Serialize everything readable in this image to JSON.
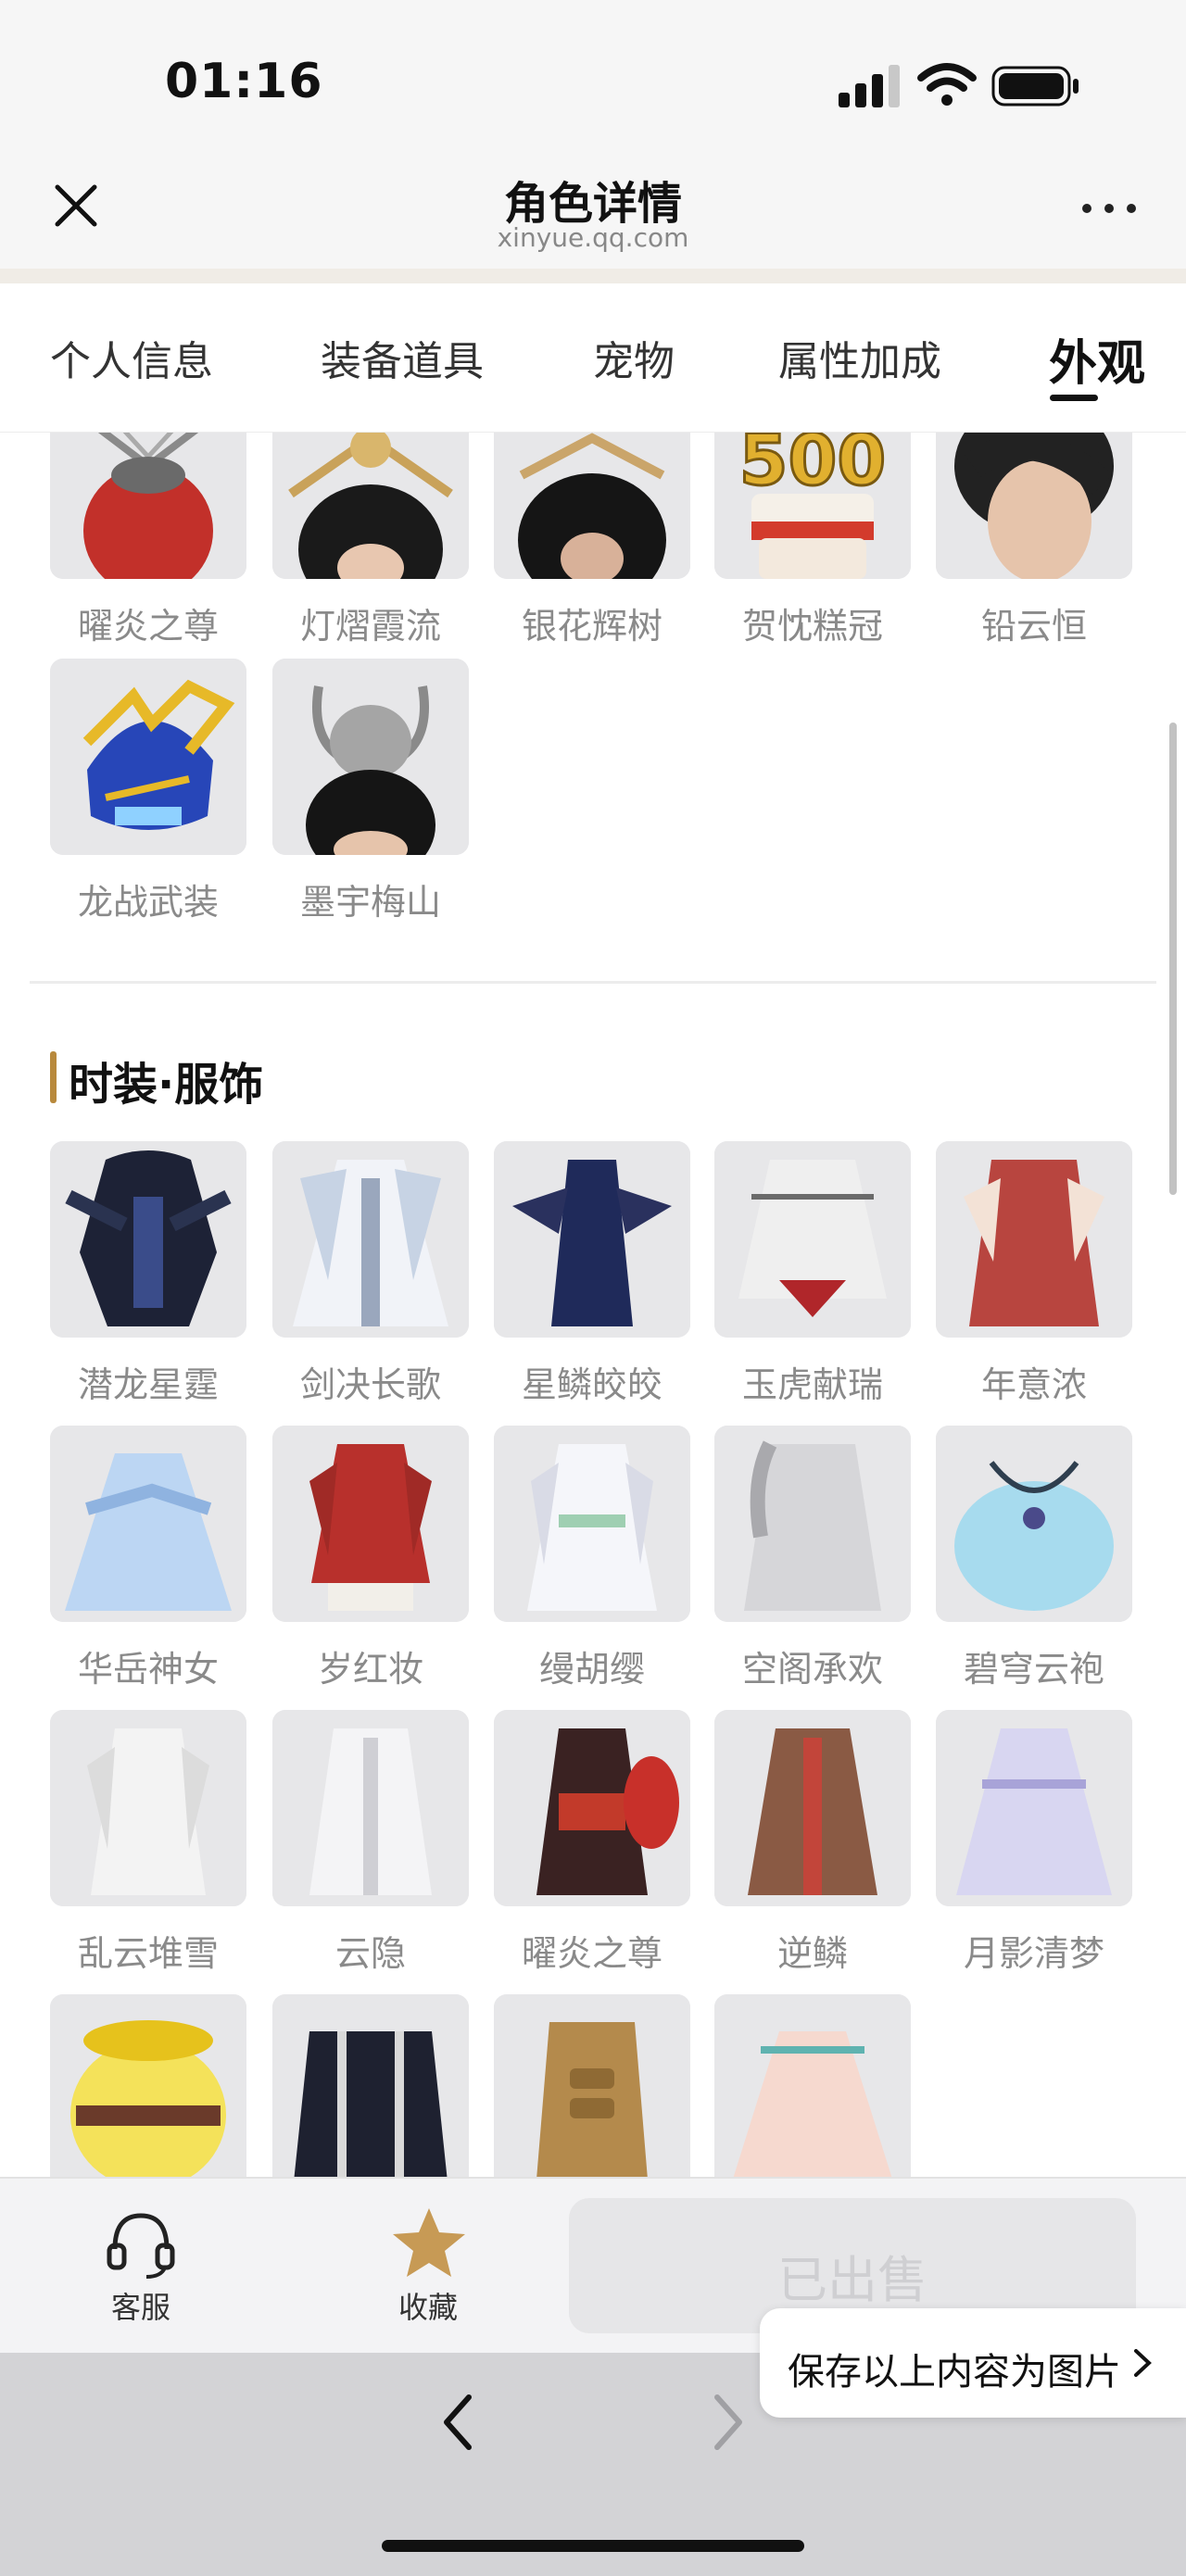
{
  "status_bar": {
    "time": "01:16"
  },
  "header": {
    "title": "角色详情",
    "subtitle": "xinyue.qq.com"
  },
  "tabs": [
    {
      "label": "个人信息",
      "active": false
    },
    {
      "label": "装备道具",
      "active": false
    },
    {
      "label": "宠物",
      "active": false
    },
    {
      "label": "属性加成",
      "active": false
    },
    {
      "label": "外观",
      "active": true
    }
  ],
  "headwear": {
    "items": [
      {
        "label": "曜炎之尊",
        "icon": "red-helmet-icon"
      },
      {
        "label": "灯熠霞流",
        "icon": "gold-crown-icon"
      },
      {
        "label": "银花辉树",
        "icon": "hairpin-crown-icon"
      },
      {
        "label": "贺忱糕冠",
        "icon": "cake-hat-500-icon"
      },
      {
        "label": "铅云恒",
        "icon": "short-hair-icon"
      },
      {
        "label": "龙战武装",
        "icon": "dragon-helmet-icon"
      },
      {
        "label": "墨宇梅山",
        "icon": "silver-horn-crown-icon"
      }
    ]
  },
  "costumes_section": {
    "title": "时装·服饰",
    "items": [
      {
        "label": "潜龙星霆",
        "icon": "dark-dragon-armor-icon"
      },
      {
        "label": "剑决长歌",
        "icon": "white-robe-icon"
      },
      {
        "label": "星鳞皎皎",
        "icon": "navy-gown-icon"
      },
      {
        "label": "玉虎献瑞",
        "icon": "white-tiger-coat-icon"
      },
      {
        "label": "年意浓",
        "icon": "red-new-year-robe-icon"
      },
      {
        "label": "华岳神女",
        "icon": "blue-dress-icon"
      },
      {
        "label": "岁红妆",
        "icon": "red-winter-dress-icon"
      },
      {
        "label": "缦胡缨",
        "icon": "white-green-robe-icon"
      },
      {
        "label": "空阁承欢",
        "icon": "silver-cloak-icon"
      },
      {
        "label": "碧穹云袍",
        "icon": "blue-cloud-robe-icon"
      },
      {
        "label": "乱云堆雪",
        "icon": "white-long-robe-icon"
      },
      {
        "label": "云隐",
        "icon": "white-coat-icon"
      },
      {
        "label": "曜炎之尊",
        "icon": "red-armor-icon"
      },
      {
        "label": "逆鳞",
        "icon": "brown-robe-icon"
      },
      {
        "label": "月影清梦",
        "icon": "lavender-dress-icon"
      },
      {
        "label": "",
        "icon": "yellow-fur-outfit-icon"
      },
      {
        "label": "",
        "icon": "black-suspenders-outfit-icon"
      },
      {
        "label": "",
        "icon": "gold-muscle-armor-icon"
      },
      {
        "label": "",
        "icon": "pink-dress-icon"
      }
    ]
  },
  "bottom_bar": {
    "service_label": "客服",
    "favorite_label": "收藏",
    "sold_label": "已出售"
  },
  "save_image_label": "保存以上内容为图片",
  "colors": {
    "accent_bar": "#b8893c",
    "favorite_star": "#c79a55",
    "thumb_bg": "#e7e7e9"
  }
}
